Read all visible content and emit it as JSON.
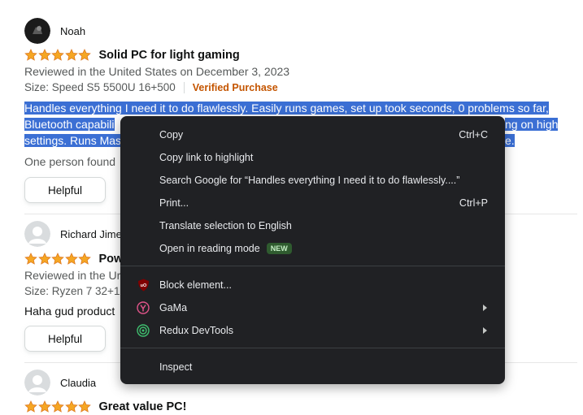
{
  "colors": {
    "star": "#f5a623",
    "selection": "#3b6fd4",
    "verified": "#c45500",
    "menu_bg": "#202124"
  },
  "reviews": [
    {
      "reviewer": "Noah",
      "rating": 5,
      "title": "Solid PC for light gaming",
      "reviewed_in": "Reviewed in the United States on December 3, 2023",
      "size": "Size: Speed S5 5500U 16+500",
      "verified": "Verified Purchase",
      "body_lines": [
        "Handles everything I need it to do flawlessly. Easily runs games, set up took seconds, 0 problems so far,",
        "Bluetooth capabili",
        "ng on high",
        "settings. Runs Mas",
        "e."
      ],
      "helpful_text": "One person found",
      "helpful_button": "Helpful"
    },
    {
      "reviewer": "Richard Jime",
      "rating": 5,
      "title": "Pow",
      "reviewed_in": "Reviewed in the Ur",
      "size": "Size: Ryzen 7 32+1",
      "body": "Haha gud product",
      "helpful_button": "Helpful"
    },
    {
      "reviewer": "Claudia",
      "rating": 5,
      "title": "Great value PC!"
    }
  ],
  "context_menu": {
    "items": [
      {
        "label": "Copy",
        "shortcut": "Ctrl+C"
      },
      {
        "label": "Copy link to highlight"
      },
      {
        "label": "Search Google for “Handles everything I need it to do flawlessly....”"
      },
      {
        "label": "Print...",
        "shortcut": "Ctrl+P"
      },
      {
        "label": "Translate selection to English"
      },
      {
        "label": "Open in reading mode",
        "badge": "NEW"
      },
      {
        "label": "Block element...",
        "icon": "ublock-origin-icon"
      },
      {
        "label": "GaMa",
        "icon": "gama-extension-icon",
        "submenu": true
      },
      {
        "label": "Redux DevTools",
        "icon": "redux-devtools-icon",
        "submenu": true
      },
      {
        "label": "Inspect"
      }
    ]
  }
}
